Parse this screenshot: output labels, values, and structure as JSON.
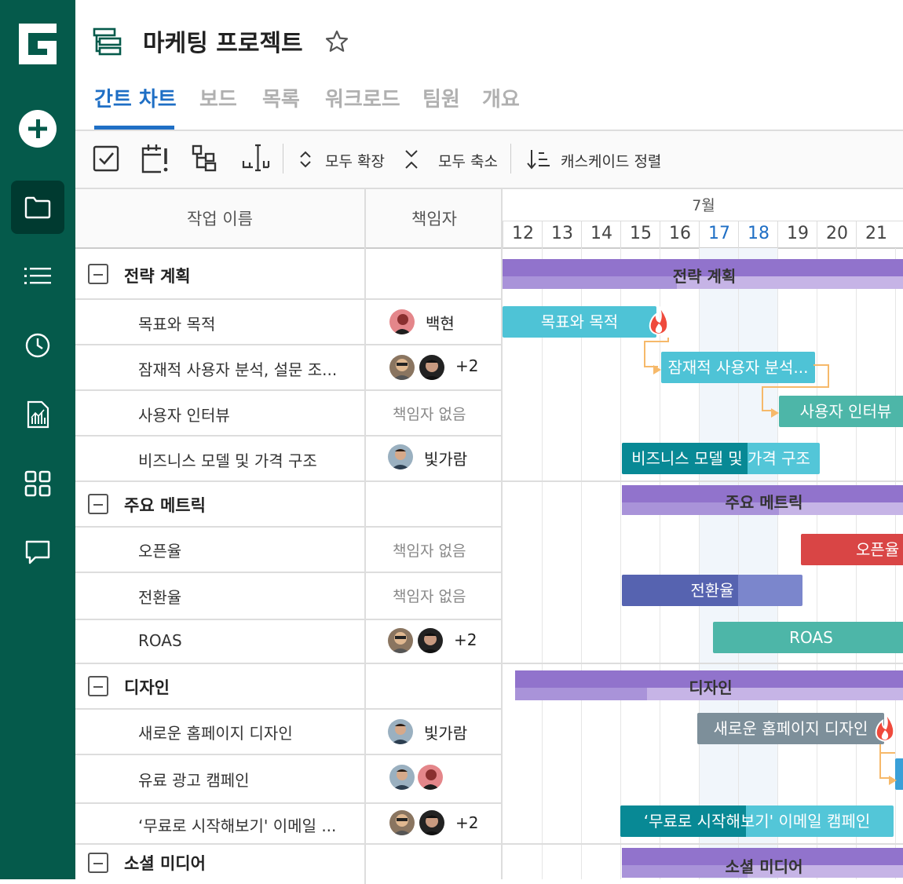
{
  "project": {
    "title": "마케팅 프로젝트"
  },
  "tabs": [
    "간트 차트",
    "보드",
    "목록",
    "워크로드",
    "팀원",
    "개요"
  ],
  "toolbar": {
    "expand_all": "모두 확장",
    "collapse_all": "모두 축소",
    "cascade_sort": "캐스케이드 정렬"
  },
  "grid": {
    "task_col": "작업 이름",
    "owner_col": "책임자"
  },
  "timeline": {
    "month": "7월",
    "days": [
      "12",
      "13",
      "14",
      "15",
      "16",
      "17",
      "18",
      "19",
      "20",
      "21"
    ]
  },
  "groups": [
    {
      "name": "전략 계획",
      "tasks": [
        {
          "name": "목표와 목적",
          "owner": "백현"
        },
        {
          "name": "잠재적 사용자 분석, 설문 조...",
          "owner_more": "+2"
        },
        {
          "name": "사용자 인터뷰",
          "owner_none": "책임자 없음"
        },
        {
          "name": "비즈니스 모델 및 가격 구조",
          "owner": "빛가람"
        }
      ]
    },
    {
      "name": "주요 메트릭",
      "tasks": [
        {
          "name": "오픈율",
          "owner_none": "책임자 없음"
        },
        {
          "name": "전환율",
          "owner_none": "책임자 없음"
        },
        {
          "name": "ROAS",
          "owner_more": "+2"
        }
      ]
    },
    {
      "name": "디자인",
      "tasks": [
        {
          "name": "새로운 홈페이지 디자인",
          "owner": "빛가람"
        },
        {
          "name": "유료 광고 캠페인"
        },
        {
          "name": "‘무료로 시작해보기' 이메일 ...",
          "owner_more": "+2"
        }
      ]
    },
    {
      "name": "소셜 미디어"
    }
  ],
  "bars": {
    "g1": "전략 계획",
    "t1": "목표와 목적",
    "t2": "잠재적 사용자 분석...",
    "t3": "사용자 인터뷰",
    "t4": "비즈니스 모델 및 가격 구조",
    "g2": "주요 메트릭",
    "t5": "오픈율",
    "t6": "전환율",
    "t7": "ROAS",
    "g3": "디자인",
    "t8": "새로운 홈페이지 디자인",
    "t10": "‘무료로 시작해보기' 이메일 캠페인",
    "g4": "소셜 미디어"
  },
  "colors": {
    "sidebar": "#055a4b",
    "accent": "#1f6fc5",
    "group_bar": "#9173cc",
    "teal": "#4ec3d6",
    "green": "#4db6a8",
    "red": "#d94545",
    "indigo": "#5663b0",
    "slate": "#7d8f9a"
  },
  "icons": {
    "sidebar": [
      "logo-icon",
      "add-icon",
      "folder-icon",
      "list-icon",
      "clock-icon",
      "report-icon",
      "apps-icon",
      "chat-icon"
    ]
  }
}
